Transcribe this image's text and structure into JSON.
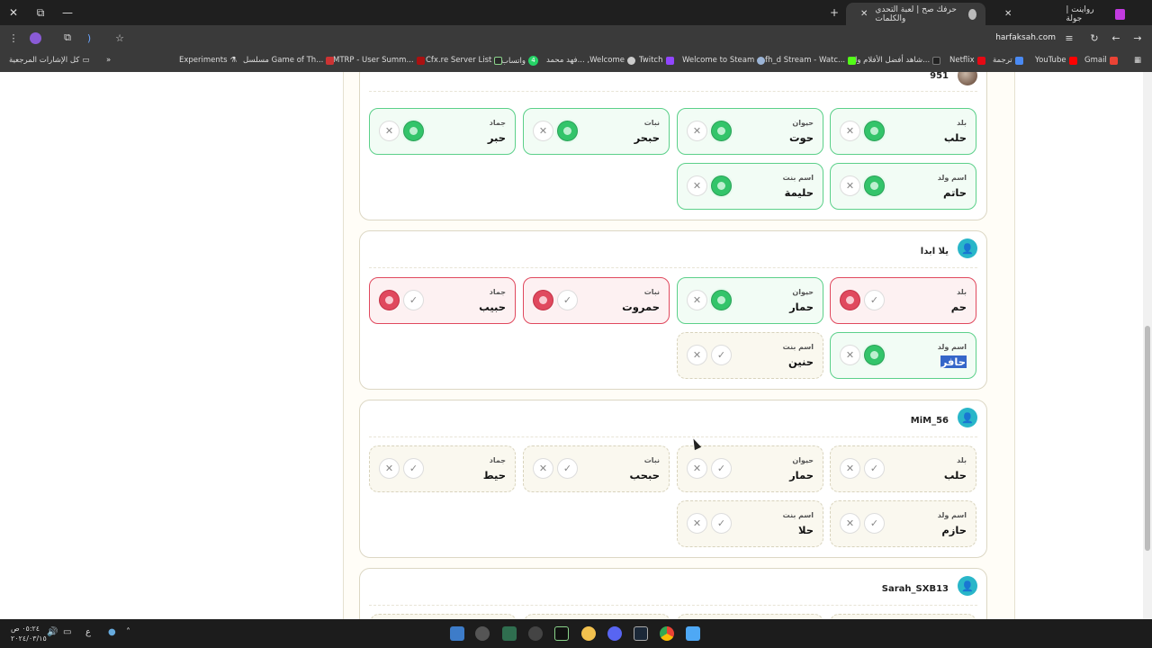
{
  "browser": {
    "tabs": [
      {
        "title": "رواينت | جولة"
      },
      {
        "title": "حرفك صح | لعبة التحدي والكلمات"
      }
    ],
    "url": "harfaksah.com",
    "bookmarks": [
      "Gmail",
      "YouTube",
      "ترجمة",
      "Netflix",
      "شاهد أفضل الأفلام وا...",
      "fh_d Stream - Watc...",
      "Welcome to Steam",
      "Twitch",
      "فهد محمد... ,Welcome",
      "واتساب",
      "Cfx.re Server List",
      "MTRP - User Summ...",
      "مسلسل Game of Th...",
      "Experiments",
      "كل الإشارات المرجعية"
    ],
    "bookmark_badge": "4"
  },
  "players": [
    {
      "name": "951",
      "fields": [
        {
          "category": "بلد",
          "word": "حلب",
          "status": "valid"
        },
        {
          "category": "حيوان",
          "word": "حوت",
          "status": "valid"
        },
        {
          "category": "نبات",
          "word": "حبحر",
          "status": "valid"
        },
        {
          "category": "جماد",
          "word": "حبر",
          "status": "valid"
        },
        {
          "category": "اسم ولد",
          "word": "حاتم",
          "status": "valid"
        },
        {
          "category": "اسم بنت",
          "word": "حليمة",
          "status": "valid"
        }
      ]
    },
    {
      "name": "يلا ابدا",
      "fields": [
        {
          "category": "بلد",
          "word": "حم",
          "status": "invalid"
        },
        {
          "category": "حيوان",
          "word": "حمار",
          "status": "valid"
        },
        {
          "category": "نبات",
          "word": "حمروت",
          "status": "invalid"
        },
        {
          "category": "جماد",
          "word": "حبيب",
          "status": "invalid"
        },
        {
          "category": "اسم ولد",
          "word": "حافر",
          "status": "valid"
        },
        {
          "category": "اسم بنت",
          "word": "حنين",
          "status": "pending"
        }
      ]
    },
    {
      "name": "MiM_56",
      "fields": [
        {
          "category": "بلد",
          "word": "حلب",
          "status": "pending"
        },
        {
          "category": "حيوان",
          "word": "حمار",
          "status": "pending"
        },
        {
          "category": "نبات",
          "word": "حبحب",
          "status": "pending"
        },
        {
          "category": "جماد",
          "word": "حيط",
          "status": "pending"
        },
        {
          "category": "اسم ولد",
          "word": "حازم",
          "status": "pending"
        },
        {
          "category": "اسم بنت",
          "word": "حلا",
          "status": "pending"
        }
      ]
    },
    {
      "name": "Sarah_SXB13"
    }
  ],
  "icons": {
    "reject": "✕",
    "accept": "✓"
  },
  "taskbar": {
    "time": "٠٥:٢٤ ص",
    "date": "٢٠٢٤/٠٣/١٥",
    "lang": "ع"
  },
  "colors": {
    "valid": "#33c46a",
    "invalid": "#e0495e",
    "avatar": "#29b6c9"
  }
}
